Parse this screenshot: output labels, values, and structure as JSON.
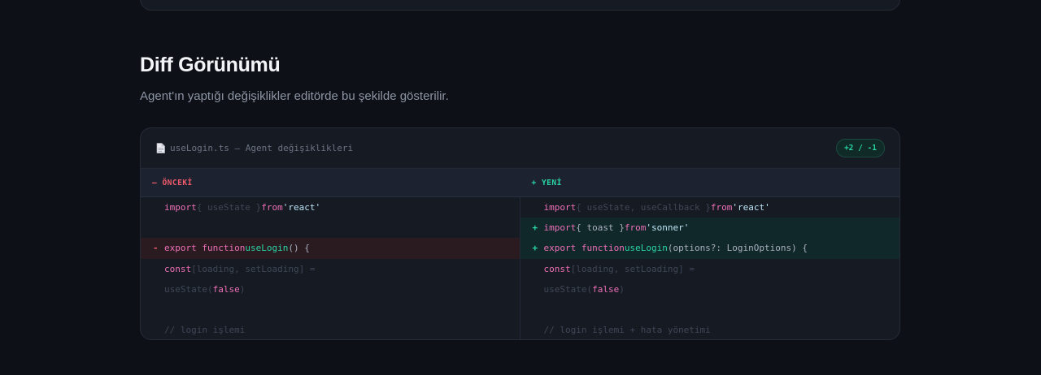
{
  "section": {
    "title": "Diff Görünümü",
    "subtitle": "Agent'ın yaptığı değişiklikler editörde bu şekilde gösterilir."
  },
  "diff": {
    "file_title": "useLogin.ts — Agent değişiklikleri",
    "stats": "+2 / -1",
    "old_header": "— ÖNCEKİ",
    "new_header": "+ YENİ",
    "old_lines": {
      "l1": {
        "kw": "import",
        "dim": "{ useState }",
        "kw2": "from",
        "str": "'react'"
      },
      "l3": {
        "marker": "-",
        "kw": "export function",
        "fn": "useLogin",
        "txt": "() {"
      },
      "l4": {
        "kw": "const",
        "dim": "[loading, setLoading] ="
      },
      "l5": {
        "dim": "useState(",
        "bool": "false",
        "dim2": ")"
      },
      "l7": {
        "cmt": "// login işlemi"
      }
    },
    "new_lines": {
      "l1": {
        "kw": "import",
        "dim": "{ useState, useCallback }",
        "kw2": "from",
        "str": "'react'"
      },
      "l2": {
        "marker": "+",
        "kw": "import",
        "txt": "{ toast }",
        "kw2": "from",
        "str": "'sonner'"
      },
      "l3": {
        "marker": "+",
        "kw": "export function",
        "fn": "useLogin",
        "txt": "(options?: LoginOptions) {"
      },
      "l4": {
        "kw": "const",
        "dim": "[loading, setLoading] ="
      },
      "l5": {
        "dim": "useState(",
        "bool": "false",
        "dim2": ")"
      },
      "l7": {
        "cmt": "// login işlemi + hata yönetimi"
      }
    }
  },
  "colors": {
    "background": "#0d1016",
    "added": "#2ad5a5",
    "removed": "#f05a6a",
    "keyword": "#ec6fb6"
  },
  "icons": {
    "file": "document-icon"
  }
}
